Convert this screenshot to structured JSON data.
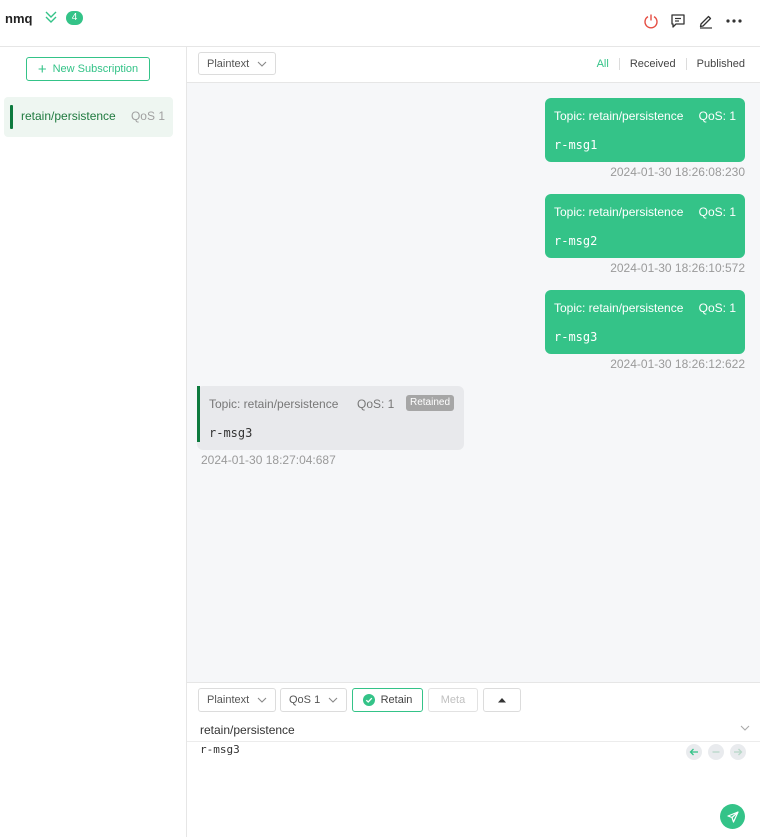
{
  "header": {
    "connection_name": "nmq",
    "badge_count": "4"
  },
  "sidebar": {
    "new_subscription_label": "New Subscription",
    "subscriptions": [
      {
        "topic": "retain/persistence",
        "qos": "QoS 1",
        "color": "#0d7a3e"
      }
    ]
  },
  "toolbar": {
    "format": "Plaintext",
    "filters": [
      "All",
      "Received",
      "Published"
    ],
    "active_filter": "All"
  },
  "messages": [
    {
      "direction": "published",
      "topic": "Topic: retain/persistence",
      "qos": "QoS: 1",
      "payload": "r-msg1",
      "time": "2024-01-30 18:26:08:230"
    },
    {
      "direction": "published",
      "topic": "Topic: retain/persistence",
      "qos": "QoS: 1",
      "payload": "r-msg2",
      "time": "2024-01-30 18:26:10:572"
    },
    {
      "direction": "published",
      "topic": "Topic: retain/persistence",
      "qos": "QoS: 1",
      "payload": "r-msg3",
      "time": "2024-01-30 18:26:12:622"
    },
    {
      "direction": "received",
      "topic": "Topic: retain/persistence",
      "qos": "QoS: 1",
      "retained_label": "Retained",
      "payload": "r-msg3",
      "time": "2024-01-30 18:27:04:687"
    }
  ],
  "publish": {
    "format": "Plaintext",
    "qos": "QoS 1",
    "retain_label": "Retain",
    "meta_label": "Meta",
    "topic": "retain/persistence",
    "payload": "r-msg3"
  },
  "colors": {
    "accent": "#34c388",
    "subscription": "#0d7a3e",
    "disconnect": "#e54d42"
  }
}
